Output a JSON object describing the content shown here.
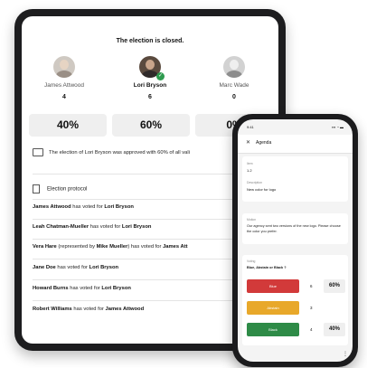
{
  "tablet": {
    "closed_title": "The election is closed.",
    "candidates": [
      {
        "name": "James Attwood",
        "votes": "4",
        "percent": "40%",
        "winner": false
      },
      {
        "name": "Lori Bryson",
        "votes": "6",
        "percent": "60%",
        "winner": true
      },
      {
        "name": "Marc Wade",
        "votes": "0",
        "percent": "0%",
        "winner": false
      }
    ],
    "approval_text": "The election of Lori Bryson was approved with 60% of all vali",
    "protocol_title": "Election protocol",
    "protocol_rows": [
      {
        "voter": "James Attwood",
        "mid": " has voted for ",
        "target": "Lori Bryson"
      },
      {
        "voter": "Leah Chatman-Mueller",
        "mid": " has voted for ",
        "target": "Lori Bryson"
      },
      {
        "voter": "Vera Hare",
        "mid": " (represented by ",
        "extra": "Mike Mueller",
        "mid2": ") has voted for ",
        "target": "James Att"
      },
      {
        "voter": "Jane Doe",
        "mid": " has voted for ",
        "target": "Lori Bryson"
      },
      {
        "voter": "Howard Burns",
        "mid": " has voted for ",
        "target": "Lori Bryson"
      },
      {
        "voter": "Robert Williams",
        "mid": " has voted for ",
        "target": "James Attwood"
      }
    ]
  },
  "phone": {
    "time": "9:41",
    "signal": "▪▪▪ ◔ ▬",
    "header_title": "Agenda",
    "close_symbol": "✕",
    "item_label": "Item",
    "item_value": "1.2",
    "desc_label": "Description",
    "desc_value": "New color for logo",
    "motion_label": "Motion",
    "motion_text": "Our agency sent two versions of the new logo. Please choose the color you prefer.",
    "voting_label": "Voting",
    "voting_question": "Blue, Abstain or Black ?",
    "options": [
      {
        "label": "Blue",
        "count": "6",
        "percent": "60%",
        "color": "#d23a3a"
      },
      {
        "label": "Abstain",
        "count": "3",
        "percent": "",
        "color": "#e8a82a"
      },
      {
        "label": "Black",
        "count": "4",
        "percent": "40%",
        "color": "#2e8b47"
      }
    ],
    "menu_dots": "⋮"
  }
}
